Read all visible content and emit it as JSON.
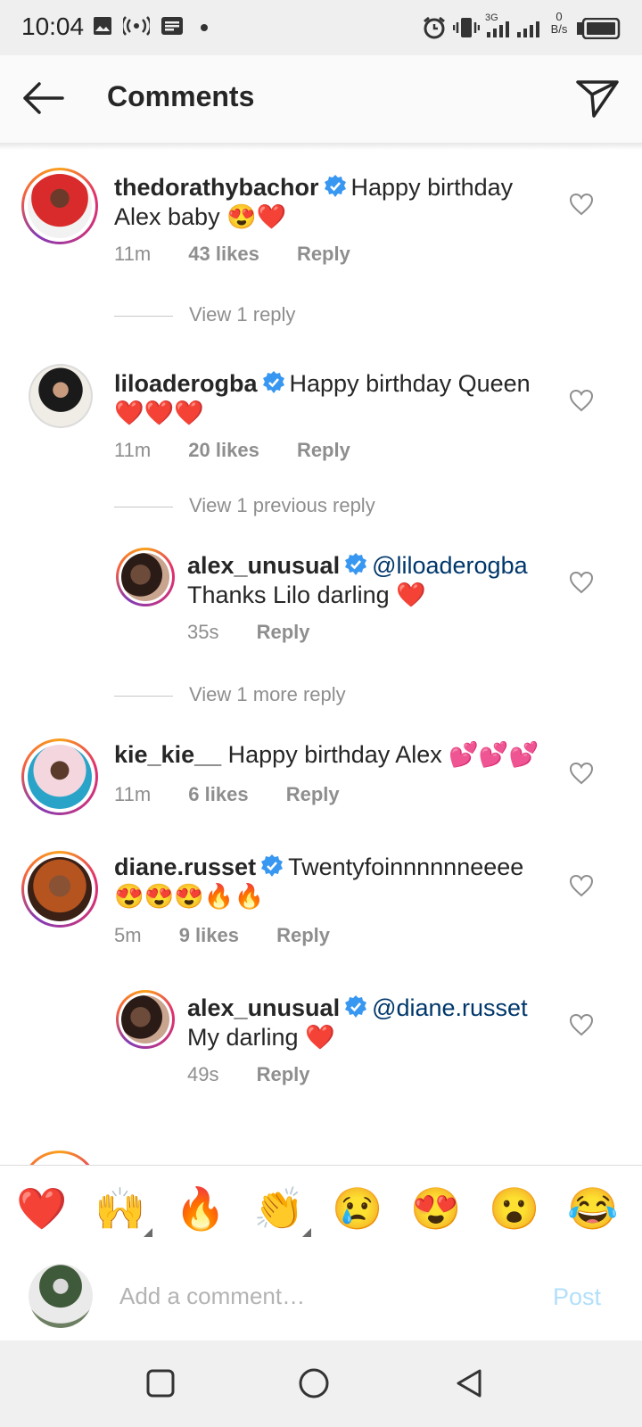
{
  "status_bar": {
    "time": "10:04",
    "network_speed_value": "0",
    "network_speed_unit": "B/s",
    "network_type": "3G",
    "icons": [
      "image-icon",
      "hotspot-icon",
      "news-icon",
      "dot-icon",
      "alarm-icon",
      "vibrate-icon",
      "signal-icon",
      "battery-icon"
    ]
  },
  "header": {
    "title": "Comments",
    "back_icon": "back-arrow-icon",
    "share_icon": "send-icon"
  },
  "comments": [
    {
      "username": "thedorathybachor",
      "verified": true,
      "text": "Happy birthday Alex baby 😍❤️",
      "time": "11m",
      "likes": "43 likes",
      "reply_label": "Reply",
      "view_replies": "View 1 reply"
    },
    {
      "username": "liloaderogba",
      "verified": true,
      "text": "Happy birthday Queen ❤️❤️❤️",
      "time": "11m",
      "likes": "20 likes",
      "reply_label": "Reply",
      "view_replies": "View 1 previous reply",
      "reply": {
        "username": "alex_unusual",
        "verified": true,
        "mention": "@liloaderogba",
        "text": "Thanks Lilo darling ❤️",
        "time": "35s",
        "reply_label": "Reply"
      },
      "view_more": "View 1 more reply"
    },
    {
      "username": "kie_kie__",
      "verified": false,
      "text": "Happy birthday Alex 💕💕💕",
      "time": "11m",
      "likes": "6 likes",
      "reply_label": "Reply"
    },
    {
      "username": "diane.russet",
      "verified": true,
      "text": "Twentyfoinnnnnneeee 😍😍😍🔥🔥",
      "time": "5m",
      "likes": "9 likes",
      "reply_label": "Reply",
      "reply": {
        "username": "alex_unusual",
        "verified": true,
        "mention": "@diane.russet",
        "text": "My darling ❤️",
        "time": "49s",
        "reply_label": "Reply"
      }
    }
  ],
  "emoji_bar": [
    "❤️",
    "🙌",
    "🔥",
    "👏",
    "😢",
    "😍",
    "😮",
    "😂"
  ],
  "add_comment": {
    "placeholder": "Add a comment…",
    "post_label": "Post"
  },
  "colors": {
    "verified_blue": "#3897f0",
    "heart_outline": "#8e8e8e",
    "post_disabled": "#b2dffc",
    "mention": "#00376b"
  }
}
